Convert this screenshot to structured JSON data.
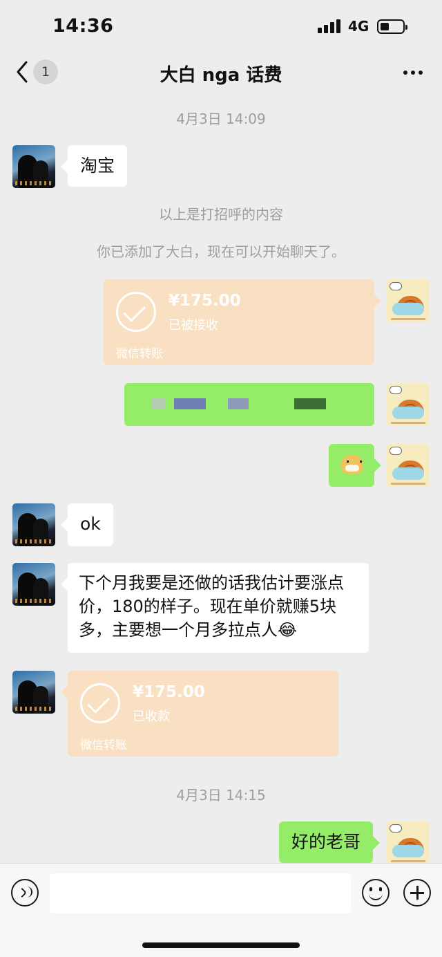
{
  "status_bar": {
    "time": "14:36",
    "network": "4G"
  },
  "nav": {
    "title": "大白 nga 话费",
    "back_badge": "1"
  },
  "messages": {
    "ts1": "4月3日 14:09",
    "m1_text": "淘宝",
    "sys1": "以上是打招呼的内容",
    "sys2": "你已添加了大白，现在可以开始聊天了。",
    "transfer1": {
      "amount": "¥175.00",
      "status": "已被接收",
      "footer": "微信转账"
    },
    "censored_note": "",
    "emoji_icon": "doge-emoji",
    "m4_text": "ok",
    "m5_text": "下个月我要是还做的话我估计要涨点价，180的样子。现在单价就赚5块多，主要想一个月多拉点人😂",
    "transfer2": {
      "amount": "¥175.00",
      "status": "已收款",
      "footer": "微信转账"
    },
    "ts2": "4月3日 14:15",
    "m7_text": "好的老哥"
  },
  "input_bar": {
    "placeholder": ""
  },
  "colors": {
    "background": "#ededed",
    "bubble_me": "#95ec69",
    "bubble_other": "#ffffff",
    "transfer": "#fae0c3"
  }
}
